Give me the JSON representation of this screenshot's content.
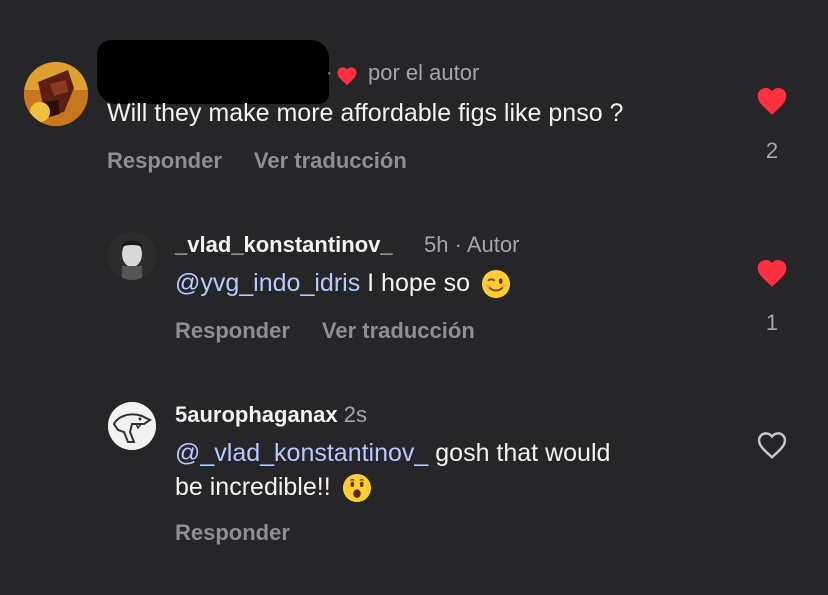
{
  "colors": {
    "background": "#262628",
    "like_red": "#ff3040",
    "muted_text": "#8e8e93",
    "mention_blue": "#b7c9ff"
  },
  "comments": [
    {
      "author_tag": "por el autor",
      "text": "Will they make more affordable figs like pnso ?",
      "actions": {
        "reply": "Responder",
        "translate": "Ver traducción"
      },
      "liked": true,
      "like_count": "2"
    },
    {
      "username": "_vlad_konstantinov_",
      "time": "5h",
      "role": "· Autor",
      "mention": "@yvg_indo_idris",
      "text": " I hope so",
      "emoji": "winking-face",
      "actions": {
        "reply": "Responder",
        "translate": "Ver traducción"
      },
      "liked": true,
      "like_count": "1"
    },
    {
      "username": "5aurophaganax",
      "time": "2s",
      "mention": "@_vlad_konstantinov_",
      "text_line1": " gosh that would",
      "text_line2": "be incredible!!",
      "emoji": "astonished-face",
      "actions": {
        "reply": "Responder"
      },
      "liked": false
    }
  ]
}
